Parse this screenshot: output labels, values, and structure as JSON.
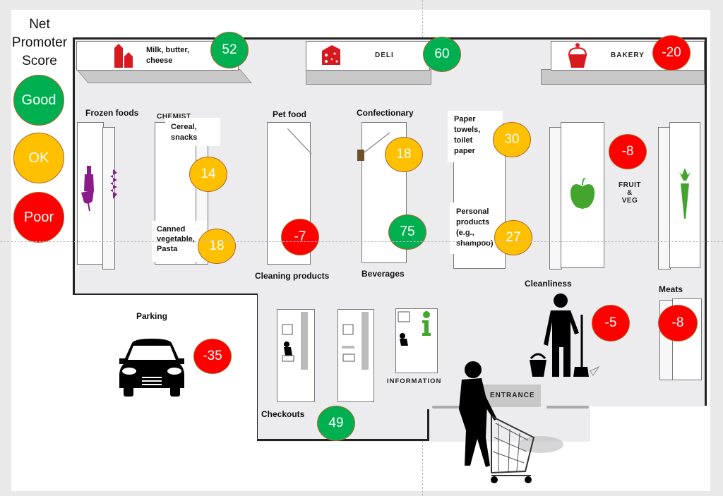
{
  "legend": {
    "title": "Net Promoter Score",
    "title_lines": [
      "Net",
      "Promoter",
      "Score"
    ],
    "items": [
      {
        "label": "Good",
        "color": "#00b050"
      },
      {
        "label": "OK",
        "color": "#ffc000"
      },
      {
        "label": "Poor",
        "color": "#ff0000"
      }
    ]
  },
  "sections": {
    "dairy": {
      "label": "Milk, butter, cheese",
      "line1": "Milk, butter,",
      "line2": "cheese",
      "score": "52",
      "rating": "Good"
    },
    "deli": {
      "label": "DELI",
      "score": "60",
      "rating": "Good"
    },
    "bakery": {
      "label": "BAKERY",
      "score": "-20",
      "rating": "Poor"
    },
    "frozen": {
      "label": "Frozen foods"
    },
    "chemist": {
      "label": "CHEMIST"
    },
    "cereal": {
      "line1": "Cereal,",
      "line2": "snacks",
      "score": "14",
      "rating": "OK"
    },
    "canned": {
      "line1": "Canned",
      "line2": "vegetable,",
      "line3": "Pasta",
      "score": "18",
      "rating": "OK"
    },
    "pet_food": {
      "label": "Pet food"
    },
    "cleaning": {
      "label": "Cleaning products",
      "score": "-7",
      "rating": "Poor"
    },
    "confectionary": {
      "label": "Confectionary",
      "score": "18",
      "rating": "OK"
    },
    "beverages": {
      "label": "Beverages",
      "score": "75",
      "rating": "Good"
    },
    "paper": {
      "line1": "Paper",
      "line2": "towels,",
      "line3": "toilet",
      "line4": "paper",
      "score": "30",
      "rating": "OK"
    },
    "personal": {
      "line1": "Personal",
      "line2": "products",
      "line3": "(e.g.,",
      "line4": "shampoo)",
      "score": "27",
      "rating": "OK"
    },
    "fruit_veg": {
      "line1": "FRUIT",
      "line2": "&",
      "line3": "VEG",
      "score": "-8",
      "rating": "Poor"
    },
    "cleanliness": {
      "label": "Cleanliness",
      "score": "-5",
      "rating": "Poor"
    },
    "meats": {
      "label": "Meats",
      "score": "-8",
      "rating": "Poor"
    },
    "parking": {
      "label": "Parking",
      "score": "-35",
      "rating": "Poor"
    },
    "checkouts": {
      "label": "Checkouts",
      "score": "49",
      "rating": "Good"
    },
    "information": {
      "label": "INFORMATION"
    },
    "entrance": {
      "label": "ENTRANCE"
    }
  }
}
